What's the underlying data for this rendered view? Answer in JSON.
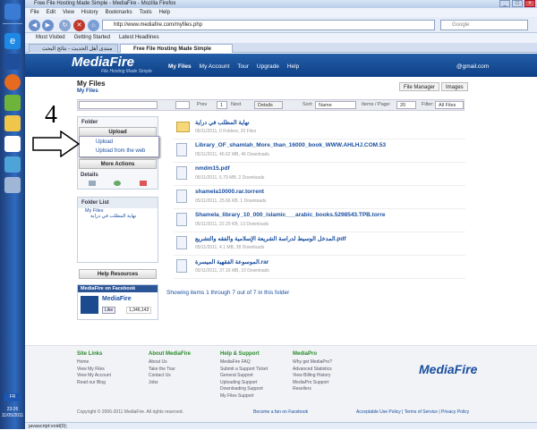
{
  "window": {
    "title": "Free File Hosting Made Simple - MediaFire - Mozilla Firefox"
  },
  "menu": [
    "File",
    "Edit",
    "View",
    "History",
    "Bookmarks",
    "Tools",
    "Help"
  ],
  "browser": {
    "url": "http://www.mediafire.com/myfiles.php",
    "search_placeholder": "Google",
    "bookmarks": [
      "Most Visited",
      "Getting Started",
      "Latest Headlines"
    ],
    "tabs": [
      "منتدى أهل الحديث - نتائج البحث",
      "Free File Hosting Made Simple"
    ]
  },
  "mf": {
    "logo": "MediaFire",
    "tagline": "File Hosting Made Simple",
    "nav": [
      "My Files",
      "My Account",
      "Tour",
      "Upgrade",
      "Help"
    ],
    "user": "@gmail.com",
    "title": "My Files",
    "crumb": "My Files",
    "view_buttons": [
      "File Manager",
      "Images"
    ]
  },
  "toolbar": {
    "prev": "Prev",
    "page": "1",
    "next": "Next",
    "details": "Details",
    "sort_label": "Sort:",
    "sort_value": "Name",
    "items_label": "Items / Page:",
    "items_value": "20",
    "filter_label": "Filter:",
    "filter_value": "All Files"
  },
  "left": {
    "folder_header": "Folder",
    "upload": "Upload",
    "upload_items": [
      "Upload",
      "Upload from the web"
    ],
    "more_actions": "More Actions",
    "details_header": "Details",
    "folder_list_header": "Folder List",
    "tree": [
      "My Files",
      "نهاية المطلب في دراية"
    ],
    "help": "Help Resources",
    "fb_header": "MediaFire on Facebook",
    "fb_name": "MediaFire",
    "fb_like": "Like",
    "fb_count": "1,346,143"
  },
  "annotation": {
    "number": "4"
  },
  "files": [
    {
      "name": "نهاية المطلب في دراية",
      "meta": "05/11/2011, 0 Folders, 20 Files",
      "type": "folder"
    },
    {
      "name": "Library_OF_shamlah_More_than_16000_book_WWW.AHLHJ.COM.53",
      "meta": "05/11/2011, 46.62 MB, 46 Downloads",
      "type": "file"
    },
    {
      "name": "nmdm15.pdf",
      "meta": "05/11/2011, 6.79 MB, 2 Downloads",
      "type": "file"
    },
    {
      "name": "shamela10000.rar.torrent",
      "meta": "05/11/2011, 25.66 KB, 1 Downloads",
      "type": "file"
    },
    {
      "name": "Shamela_library_10_000_islamic___arabic_books.5298543.TPB.torre",
      "meta": "05/11/2011, 22.29 KB, 13 Downloads",
      "type": "file"
    },
    {
      "name": "المدخل الوسيط لدراسة الشريعة الإسلامية والفقه والتشريع.pdf",
      "meta": "05/11/2011, 4.1 MB, 38 Downloads",
      "type": "file"
    },
    {
      "name": "الموسوعة الفقهية الميسرة.rar",
      "meta": "05/11/2011, 37.16 MB, 10 Downloads",
      "type": "file"
    }
  ],
  "showing": "Showing items 1 through 7 out of 7 in this folder",
  "footer": {
    "cols": [
      {
        "h": "Site Links",
        "items": [
          "Home",
          "View My Files",
          "View My Account",
          "Read our Blog"
        ]
      },
      {
        "h": "About MediaFire",
        "items": [
          "About Us",
          "Take the Tour",
          "Contact Us",
          "Jobs"
        ]
      },
      {
        "h": "Help & Support",
        "items": [
          "MediaFire FAQ",
          "Submit a Support Ticket",
          "General Support",
          "Uploading Support",
          "Downloading Support",
          "My Files Support"
        ]
      },
      {
        "h": "MediaPro",
        "items": [
          "Why get MediaPro?",
          "Advanced Statistics",
          "View Billing History",
          "MediaPro Support",
          "Resellers"
        ]
      }
    ],
    "copyright": "Copyright © 2006-2011 MediaFire. All rights reserved.",
    "fan": "Become a fan on Facebook",
    "legal": "Acceptable Use Policy | Terms of Service | Privacy Policy",
    "logo": "MediaFire"
  },
  "status": "javascript:void(0);",
  "system": {
    "time": "23:26",
    "date": "11/05/2011",
    "lang": "FR"
  }
}
